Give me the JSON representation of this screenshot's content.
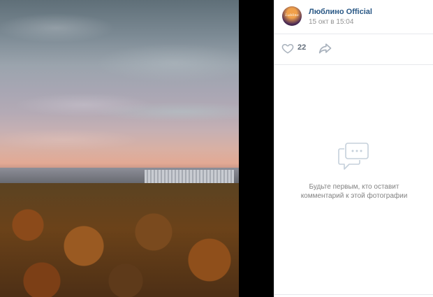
{
  "post": {
    "author": "Люблино Official",
    "date": "15 окт в 15:04",
    "avatar_text": "Lublino"
  },
  "actions": {
    "like_icon": "heart-outline-icon",
    "like_count": "22",
    "share_icon": "share-arrow-icon"
  },
  "comments": {
    "icon": "comment-bubble-icon",
    "empty_line1": "Будьте первым, кто оставит",
    "empty_line2": "комментарий к этой фотографии"
  },
  "colors": {
    "author_link": "#2a5885",
    "muted": "#939393",
    "icon_gray": "#a9b2bd"
  }
}
